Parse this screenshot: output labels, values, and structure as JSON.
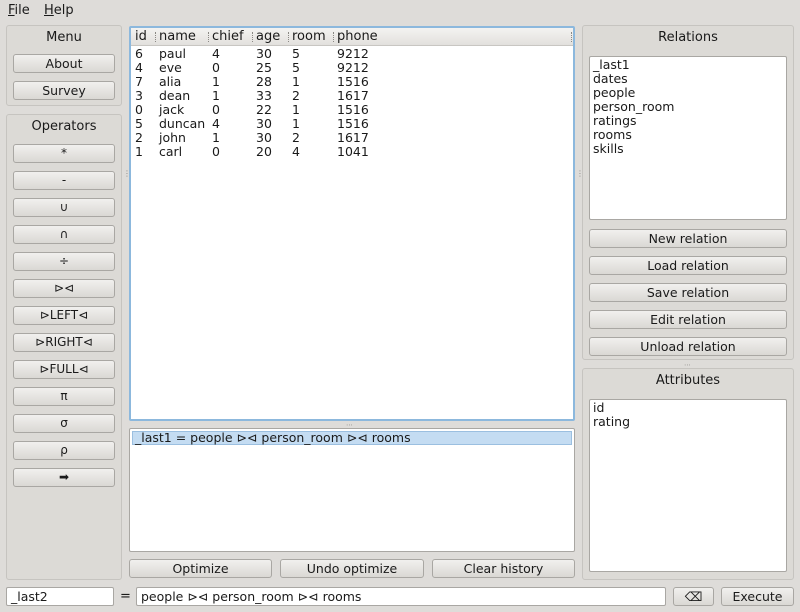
{
  "menubar": {
    "file": "File",
    "help": "Help"
  },
  "menu_group": {
    "title": "Menu",
    "about": "About",
    "survey": "Survey"
  },
  "operators_group": {
    "title": "Operators",
    "ops": [
      "*",
      "-",
      "∪",
      "∩",
      "÷",
      "⊳⊲",
      "⊳LEFT⊲",
      "⊳RIGHT⊲",
      "⊳FULL⊲",
      "π",
      "σ",
      "ρ",
      "➡"
    ]
  },
  "table": {
    "columns": [
      "id",
      "name",
      "chief",
      "age",
      "room",
      "phone"
    ],
    "rows": [
      [
        "6",
        "paul",
        "4",
        "30",
        "5",
        "9212"
      ],
      [
        "4",
        "eve",
        "0",
        "25",
        "5",
        "9212"
      ],
      [
        "7",
        "alia",
        "1",
        "28",
        "1",
        "1516"
      ],
      [
        "3",
        "dean",
        "1",
        "33",
        "2",
        "1617"
      ],
      [
        "0",
        "jack",
        "0",
        "22",
        "1",
        "1516"
      ],
      [
        "5",
        "duncan",
        "4",
        "30",
        "1",
        "1516"
      ],
      [
        "2",
        "john",
        "1",
        "30",
        "2",
        "1617"
      ],
      [
        "1",
        "carl",
        "0",
        "20",
        "4",
        "1041"
      ]
    ]
  },
  "history": {
    "items": [
      "_last1 = people ⊳⊲ person_room ⊳⊲ rooms"
    ]
  },
  "history_buttons": {
    "optimize": "Optimize",
    "undo": "Undo optimize",
    "clear": "Clear history"
  },
  "relations_group": {
    "title": "Relations",
    "items": [
      "_last1",
      "dates",
      "people",
      "person_room",
      "ratings",
      "rooms",
      "skills"
    ],
    "buttons": {
      "new": "New relation",
      "load": "Load relation",
      "save": "Save relation",
      "edit": "Edit relation",
      "unload": "Unload relation"
    }
  },
  "attributes_group": {
    "title": "Attributes",
    "items": [
      "id",
      "rating"
    ]
  },
  "query_bar": {
    "result_name": "_last2",
    "equals": "=",
    "query": "people ⊳⊲ person_room ⊳⊲ rooms",
    "clear_icon": "⌫",
    "execute": "Execute"
  },
  "colors": {
    "window_bg": "#dedcd9",
    "focus_border": "#8cb8dd",
    "selection": "#c4dcf2"
  }
}
